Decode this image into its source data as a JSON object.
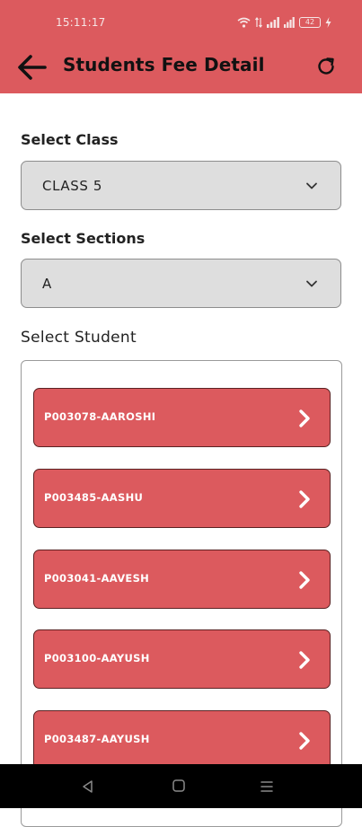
{
  "status_bar": {
    "time": "15:11:17",
    "battery": "42"
  },
  "header": {
    "title": "Students Fee Detail"
  },
  "form": {
    "class_label": "Select Class",
    "class_value": "CLASS 5",
    "section_label": "Select Sections",
    "section_value": "A",
    "student_label": "Select Student"
  },
  "students": [
    {
      "name": "P003078-AAROSHI"
    },
    {
      "name": "P003485-AASHU"
    },
    {
      "name": "P003041-AAVESH"
    },
    {
      "name": "P003100-AAYUSH"
    },
    {
      "name": "P003487-AAYUSH"
    }
  ],
  "icons": {
    "back": "arrow-left-icon",
    "refresh": "refresh-icon",
    "dropdown": "chevron-down-icon",
    "row": "chevron-right-icon"
  },
  "colors": {
    "accent": "#dc5a5e",
    "select_bg": "#dedede",
    "navbar": "#000000"
  }
}
